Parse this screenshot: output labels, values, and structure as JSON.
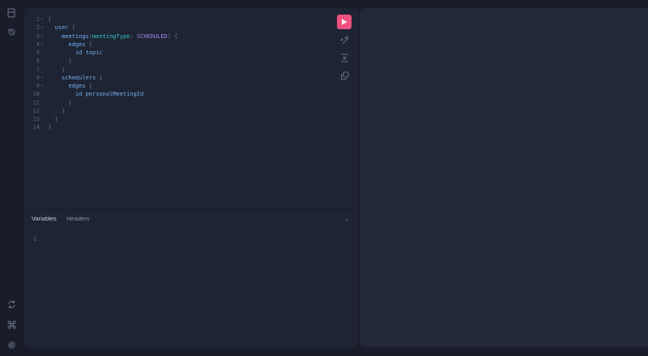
{
  "sidebar": {
    "top": [
      "docs-icon",
      "history-icon"
    ],
    "bottom": [
      "refresh-icon",
      "command-icon",
      "settings-icon"
    ]
  },
  "query": {
    "lines": [
      {
        "n": "1",
        "fold": true,
        "tokens": [
          [
            "p",
            "{"
          ]
        ]
      },
      {
        "n": "2",
        "fold": true,
        "tokens": [
          [
            "p",
            "  "
          ],
          [
            "f",
            "user"
          ],
          [
            "p",
            " {"
          ]
        ]
      },
      {
        "n": "3",
        "fold": true,
        "tokens": [
          [
            "p",
            "    "
          ],
          [
            "f",
            "meetings"
          ],
          [
            "p",
            "("
          ],
          [
            "a",
            "meetingType"
          ],
          [
            "p",
            ": "
          ],
          [
            "e",
            "SCHEDULED"
          ],
          [
            "p",
            ") {"
          ]
        ]
      },
      {
        "n": "4",
        "fold": true,
        "tokens": [
          [
            "p",
            "      "
          ],
          [
            "f",
            "edges"
          ],
          [
            "p",
            " {"
          ]
        ]
      },
      {
        "n": "5",
        "fold": false,
        "tokens": [
          [
            "p",
            "        "
          ],
          [
            "f",
            "id topic"
          ]
        ]
      },
      {
        "n": "6",
        "fold": false,
        "tokens": [
          [
            "p",
            "      }"
          ]
        ]
      },
      {
        "n": "7",
        "fold": false,
        "tokens": [
          [
            "p",
            "    }"
          ]
        ]
      },
      {
        "n": "8",
        "fold": true,
        "tokens": [
          [
            "p",
            "    "
          ],
          [
            "f",
            "schedulers"
          ],
          [
            "p",
            " {"
          ]
        ]
      },
      {
        "n": "9",
        "fold": true,
        "tokens": [
          [
            "p",
            "      "
          ],
          [
            "f",
            "edges"
          ],
          [
            "p",
            " {"
          ]
        ]
      },
      {
        "n": "10",
        "fold": false,
        "tokens": [
          [
            "p",
            "        "
          ],
          [
            "f",
            "id personalMeetingId"
          ]
        ]
      },
      {
        "n": "11",
        "fold": false,
        "tokens": [
          [
            "p",
            "      }"
          ]
        ]
      },
      {
        "n": "12",
        "fold": false,
        "tokens": [
          [
            "p",
            "    }"
          ]
        ]
      },
      {
        "n": "13",
        "fold": false,
        "tokens": [
          [
            "p",
            "  }"
          ]
        ]
      },
      {
        "n": "14",
        "fold": false,
        "tokens": [
          [
            "p",
            "}"
          ]
        ]
      }
    ]
  },
  "toolbar": {
    "run": "play-icon",
    "prettify": "prettify-icon",
    "merge": "merge-icon",
    "copy": "copy-icon"
  },
  "variables": {
    "tabs": [
      "Variables",
      "Headers"
    ],
    "line": "1"
  },
  "colors": {
    "run": "#f0507f",
    "field": "#73aef0",
    "arg": "#2ec2c8",
    "enum": "#9c8cf0"
  }
}
